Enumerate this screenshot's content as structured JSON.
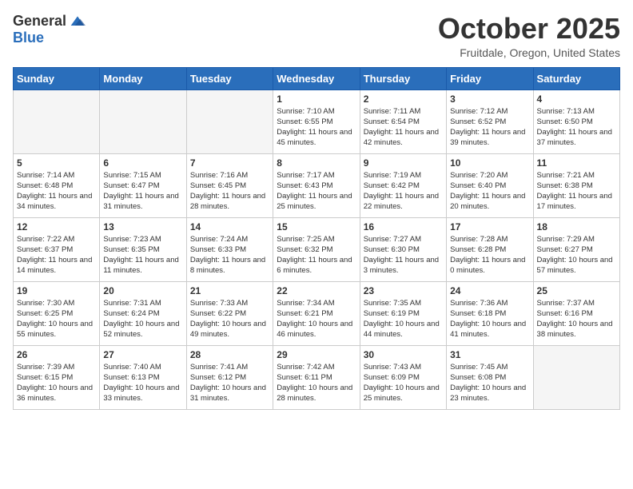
{
  "header": {
    "logo_general": "General",
    "logo_blue": "Blue",
    "month_title": "October 2025",
    "location": "Fruitdale, Oregon, United States"
  },
  "days_of_week": [
    "Sunday",
    "Monday",
    "Tuesday",
    "Wednesday",
    "Thursday",
    "Friday",
    "Saturday"
  ],
  "weeks": [
    [
      {
        "day": "",
        "info": ""
      },
      {
        "day": "",
        "info": ""
      },
      {
        "day": "",
        "info": ""
      },
      {
        "day": "1",
        "info": "Sunrise: 7:10 AM\nSunset: 6:55 PM\nDaylight: 11 hours and 45 minutes."
      },
      {
        "day": "2",
        "info": "Sunrise: 7:11 AM\nSunset: 6:54 PM\nDaylight: 11 hours and 42 minutes."
      },
      {
        "day": "3",
        "info": "Sunrise: 7:12 AM\nSunset: 6:52 PM\nDaylight: 11 hours and 39 minutes."
      },
      {
        "day": "4",
        "info": "Sunrise: 7:13 AM\nSunset: 6:50 PM\nDaylight: 11 hours and 37 minutes."
      }
    ],
    [
      {
        "day": "5",
        "info": "Sunrise: 7:14 AM\nSunset: 6:48 PM\nDaylight: 11 hours and 34 minutes."
      },
      {
        "day": "6",
        "info": "Sunrise: 7:15 AM\nSunset: 6:47 PM\nDaylight: 11 hours and 31 minutes."
      },
      {
        "day": "7",
        "info": "Sunrise: 7:16 AM\nSunset: 6:45 PM\nDaylight: 11 hours and 28 minutes."
      },
      {
        "day": "8",
        "info": "Sunrise: 7:17 AM\nSunset: 6:43 PM\nDaylight: 11 hours and 25 minutes."
      },
      {
        "day": "9",
        "info": "Sunrise: 7:19 AM\nSunset: 6:42 PM\nDaylight: 11 hours and 22 minutes."
      },
      {
        "day": "10",
        "info": "Sunrise: 7:20 AM\nSunset: 6:40 PM\nDaylight: 11 hours and 20 minutes."
      },
      {
        "day": "11",
        "info": "Sunrise: 7:21 AM\nSunset: 6:38 PM\nDaylight: 11 hours and 17 minutes."
      }
    ],
    [
      {
        "day": "12",
        "info": "Sunrise: 7:22 AM\nSunset: 6:37 PM\nDaylight: 11 hours and 14 minutes."
      },
      {
        "day": "13",
        "info": "Sunrise: 7:23 AM\nSunset: 6:35 PM\nDaylight: 11 hours and 11 minutes."
      },
      {
        "day": "14",
        "info": "Sunrise: 7:24 AM\nSunset: 6:33 PM\nDaylight: 11 hours and 8 minutes."
      },
      {
        "day": "15",
        "info": "Sunrise: 7:25 AM\nSunset: 6:32 PM\nDaylight: 11 hours and 6 minutes."
      },
      {
        "day": "16",
        "info": "Sunrise: 7:27 AM\nSunset: 6:30 PM\nDaylight: 11 hours and 3 minutes."
      },
      {
        "day": "17",
        "info": "Sunrise: 7:28 AM\nSunset: 6:28 PM\nDaylight: 11 hours and 0 minutes."
      },
      {
        "day": "18",
        "info": "Sunrise: 7:29 AM\nSunset: 6:27 PM\nDaylight: 10 hours and 57 minutes."
      }
    ],
    [
      {
        "day": "19",
        "info": "Sunrise: 7:30 AM\nSunset: 6:25 PM\nDaylight: 10 hours and 55 minutes."
      },
      {
        "day": "20",
        "info": "Sunrise: 7:31 AM\nSunset: 6:24 PM\nDaylight: 10 hours and 52 minutes."
      },
      {
        "day": "21",
        "info": "Sunrise: 7:33 AM\nSunset: 6:22 PM\nDaylight: 10 hours and 49 minutes."
      },
      {
        "day": "22",
        "info": "Sunrise: 7:34 AM\nSunset: 6:21 PM\nDaylight: 10 hours and 46 minutes."
      },
      {
        "day": "23",
        "info": "Sunrise: 7:35 AM\nSunset: 6:19 PM\nDaylight: 10 hours and 44 minutes."
      },
      {
        "day": "24",
        "info": "Sunrise: 7:36 AM\nSunset: 6:18 PM\nDaylight: 10 hours and 41 minutes."
      },
      {
        "day": "25",
        "info": "Sunrise: 7:37 AM\nSunset: 6:16 PM\nDaylight: 10 hours and 38 minutes."
      }
    ],
    [
      {
        "day": "26",
        "info": "Sunrise: 7:39 AM\nSunset: 6:15 PM\nDaylight: 10 hours and 36 minutes."
      },
      {
        "day": "27",
        "info": "Sunrise: 7:40 AM\nSunset: 6:13 PM\nDaylight: 10 hours and 33 minutes."
      },
      {
        "day": "28",
        "info": "Sunrise: 7:41 AM\nSunset: 6:12 PM\nDaylight: 10 hours and 31 minutes."
      },
      {
        "day": "29",
        "info": "Sunrise: 7:42 AM\nSunset: 6:11 PM\nDaylight: 10 hours and 28 minutes."
      },
      {
        "day": "30",
        "info": "Sunrise: 7:43 AM\nSunset: 6:09 PM\nDaylight: 10 hours and 25 minutes."
      },
      {
        "day": "31",
        "info": "Sunrise: 7:45 AM\nSunset: 6:08 PM\nDaylight: 10 hours and 23 minutes."
      },
      {
        "day": "",
        "info": ""
      }
    ]
  ],
  "colors": {
    "header_bg": "#2a6ebb",
    "header_text": "#ffffff",
    "title_color": "#333333",
    "accent": "#2a6ebb"
  }
}
